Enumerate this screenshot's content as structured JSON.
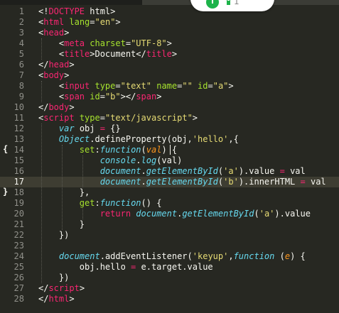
{
  "status_pill": {
    "count": "1"
  },
  "editor": {
    "active_line": 17,
    "fold_markers": [
      {
        "line": 14,
        "glyph": "{"
      },
      {
        "line": 18,
        "glyph": "}"
      }
    ],
    "lines": [
      {
        "n": "1",
        "tokens": [
          [
            "pun",
            "<!"
          ],
          [
            "tag",
            "DOCTYPE"
          ],
          [
            "pun",
            " html>"
          ]
        ]
      },
      {
        "n": "2",
        "tokens": [
          [
            "pun",
            "<"
          ],
          [
            "tag",
            "html"
          ],
          [
            "pun",
            " "
          ],
          [
            "attr",
            "lang"
          ],
          [
            "pun",
            "="
          ],
          [
            "str",
            "\"en\""
          ],
          [
            "pun",
            ">"
          ]
        ]
      },
      {
        "n": "3",
        "tokens": [
          [
            "pun",
            "<"
          ],
          [
            "tag",
            "head"
          ],
          [
            "pun",
            ">"
          ]
        ]
      },
      {
        "n": "4",
        "tokens": [
          [
            "pun",
            "    <"
          ],
          [
            "tag",
            "meta"
          ],
          [
            "pun",
            " "
          ],
          [
            "attr",
            "charset"
          ],
          [
            "pun",
            "="
          ],
          [
            "str",
            "\"UTF-8\""
          ],
          [
            "pun",
            ">"
          ]
        ]
      },
      {
        "n": "5",
        "tokens": [
          [
            "pun",
            "    <"
          ],
          [
            "tag",
            "title"
          ],
          [
            "pun",
            ">Document</"
          ],
          [
            "tag",
            "title"
          ],
          [
            "pun",
            ">"
          ]
        ]
      },
      {
        "n": "6",
        "tokens": [
          [
            "pun",
            "</"
          ],
          [
            "tag",
            "head"
          ],
          [
            "pun",
            ">"
          ]
        ]
      },
      {
        "n": "7",
        "tokens": [
          [
            "pun",
            "<"
          ],
          [
            "tag",
            "body"
          ],
          [
            "pun",
            ">"
          ]
        ]
      },
      {
        "n": "8",
        "tokens": [
          [
            "pun",
            "    <"
          ],
          [
            "tag",
            "input"
          ],
          [
            "pun",
            " "
          ],
          [
            "attr",
            "type"
          ],
          [
            "pun",
            "="
          ],
          [
            "str",
            "\"text\""
          ],
          [
            "pun",
            " "
          ],
          [
            "attr",
            "name"
          ],
          [
            "pun",
            "="
          ],
          [
            "str",
            "\"\""
          ],
          [
            "pun",
            " "
          ],
          [
            "attr",
            "id"
          ],
          [
            "pun",
            "="
          ],
          [
            "str",
            "\"a\""
          ],
          [
            "pun",
            ">"
          ]
        ]
      },
      {
        "n": "9",
        "tokens": [
          [
            "pun",
            "    <"
          ],
          [
            "tag",
            "span"
          ],
          [
            "pun",
            " "
          ],
          [
            "attr",
            "id"
          ],
          [
            "pun",
            "="
          ],
          [
            "str",
            "\"b\""
          ],
          [
            "pun",
            "></"
          ],
          [
            "tag",
            "span"
          ],
          [
            "pun",
            ">"
          ]
        ]
      },
      {
        "n": "10",
        "tokens": [
          [
            "pun",
            "</"
          ],
          [
            "tag",
            "body"
          ],
          [
            "pun",
            ">"
          ]
        ]
      },
      {
        "n": "11",
        "tokens": [
          [
            "pun",
            "<"
          ],
          [
            "tag",
            "script"
          ],
          [
            "pun",
            " "
          ],
          [
            "attr",
            "type"
          ],
          [
            "pun",
            "="
          ],
          [
            "str",
            "\"text/javascript\""
          ],
          [
            "pun",
            ">"
          ]
        ]
      },
      {
        "n": "12",
        "tokens": [
          [
            "pun",
            "    "
          ],
          [
            "kw",
            "var"
          ],
          [
            "pun",
            " obj "
          ],
          [
            "key",
            "="
          ],
          [
            "pun",
            " {}"
          ]
        ]
      },
      {
        "n": "13",
        "tokens": [
          [
            "pun",
            "    "
          ],
          [
            "fn",
            "Object"
          ],
          [
            "pun",
            "."
          ],
          [
            "pun",
            "defineProperty(obj,"
          ],
          [
            "str",
            "'hello'"
          ],
          [
            "pun",
            ",{"
          ]
        ]
      },
      {
        "n": "14",
        "tokens": [
          [
            "pun",
            "        "
          ],
          [
            "id",
            "set"
          ],
          [
            "pun",
            ":"
          ],
          [
            "kw",
            "function"
          ],
          [
            "pun",
            "("
          ],
          [
            "param",
            "val"
          ],
          [
            "pun",
            ") {"
          ]
        ]
      },
      {
        "n": "15",
        "tokens": [
          [
            "pun",
            "            "
          ],
          [
            "fn",
            "console"
          ],
          [
            "pun",
            "."
          ],
          [
            "fn",
            "log"
          ],
          [
            "pun",
            "(val)"
          ]
        ]
      },
      {
        "n": "16",
        "tokens": [
          [
            "pun",
            "            "
          ],
          [
            "fn",
            "document"
          ],
          [
            "pun",
            "."
          ],
          [
            "fn",
            "getElementById"
          ],
          [
            "pun",
            "("
          ],
          [
            "str",
            "'a'"
          ],
          [
            "pun",
            ").value "
          ],
          [
            "key",
            "="
          ],
          [
            "pun",
            " val"
          ]
        ]
      },
      {
        "n": "17",
        "tokens": [
          [
            "pun",
            "            "
          ],
          [
            "fn",
            "document"
          ],
          [
            "pun",
            "."
          ],
          [
            "fn",
            "getElementById"
          ],
          [
            "pun",
            "("
          ],
          [
            "str",
            "'b'"
          ],
          [
            "pun",
            ").innerHTML "
          ],
          [
            "key",
            "="
          ],
          [
            "pun",
            " val"
          ]
        ]
      },
      {
        "n": "18",
        "tokens": [
          [
            "pun",
            "        },"
          ]
        ]
      },
      {
        "n": "19",
        "tokens": [
          [
            "pun",
            "        "
          ],
          [
            "id",
            "get"
          ],
          [
            "pun",
            ":"
          ],
          [
            "kw",
            "function"
          ],
          [
            "pun",
            "() {"
          ]
        ]
      },
      {
        "n": "20",
        "tokens": [
          [
            "pun",
            "            "
          ],
          [
            "key",
            "return"
          ],
          [
            "pun",
            " "
          ],
          [
            "fn",
            "document"
          ],
          [
            "pun",
            "."
          ],
          [
            "fn",
            "getElementById"
          ],
          [
            "pun",
            "("
          ],
          [
            "str",
            "'a'"
          ],
          [
            "pun",
            ").value"
          ]
        ]
      },
      {
        "n": "21",
        "tokens": [
          [
            "pun",
            "        }"
          ]
        ]
      },
      {
        "n": "22",
        "tokens": [
          [
            "pun",
            "    })"
          ]
        ]
      },
      {
        "n": "23",
        "tokens": []
      },
      {
        "n": "24",
        "tokens": [
          [
            "pun",
            "    "
          ],
          [
            "fn",
            "document"
          ],
          [
            "pun",
            "."
          ],
          [
            "pun",
            "addEventListener("
          ],
          [
            "str",
            "'keyup'"
          ],
          [
            "pun",
            ","
          ],
          [
            "kw",
            "function"
          ],
          [
            "pun",
            " ("
          ],
          [
            "param",
            "e"
          ],
          [
            "pun",
            ") {"
          ]
        ]
      },
      {
        "n": "25",
        "tokens": [
          [
            "pun",
            "        obj.hello "
          ],
          [
            "key",
            "="
          ],
          [
            "pun",
            " e.target.value"
          ]
        ]
      },
      {
        "n": "26",
        "tokens": [
          [
            "pun",
            "    })"
          ]
        ]
      },
      {
        "n": "27",
        "tokens": [
          [
            "pun",
            "</"
          ],
          [
            "tag",
            "script"
          ],
          [
            "pun",
            ">"
          ]
        ]
      },
      {
        "n": "28",
        "tokens": [
          [
            "pun",
            "</"
          ],
          [
            "tag",
            "html"
          ],
          [
            "pun",
            ">"
          ]
        ]
      }
    ]
  }
}
